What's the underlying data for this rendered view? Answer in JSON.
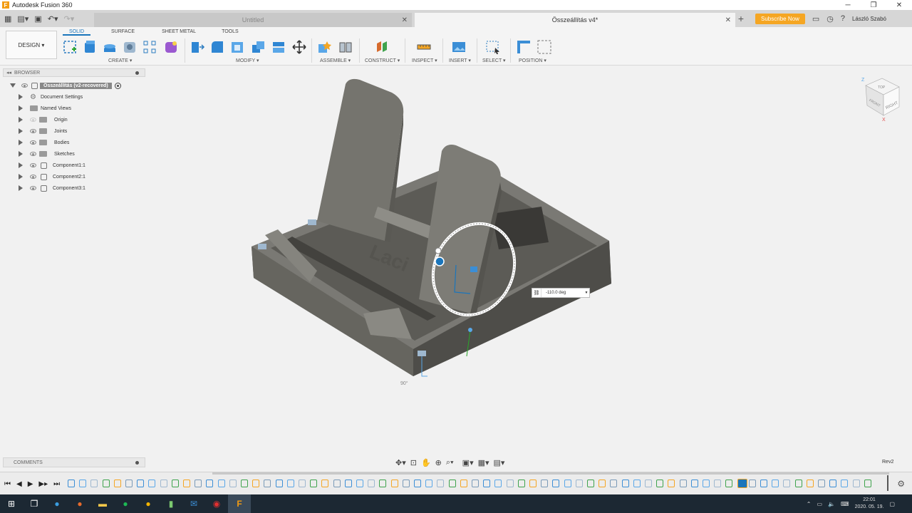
{
  "window": {
    "title": "Autodesk Fusion 360",
    "app_logo": "F"
  },
  "tabs": [
    {
      "label": "Untitled",
      "active": false
    },
    {
      "label": "Összeállítás v4*",
      "active": true
    }
  ],
  "header": {
    "subscribe_label": "Subscribe Now",
    "user_name": "László Szabó"
  },
  "ribbon": {
    "workspace_label": "DESIGN ▾",
    "workspace_tabs": [
      "SOLID",
      "SURFACE",
      "SHEET METAL",
      "TOOLS"
    ],
    "groups": [
      "CREATE ▾",
      "MODIFY ▾",
      "ASSEMBLE ▾",
      "CONSTRUCT ▾",
      "INSPECT ▾",
      "INSERT ▾",
      "SELECT ▾",
      "POSITION ▾"
    ]
  },
  "browser": {
    "title": "BROWSER",
    "root": "Összeállítás (v2-recovered)",
    "items": [
      {
        "label": "Document Settings",
        "icon": "gear-icon"
      },
      {
        "label": "Named Views",
        "icon": "folder-icon"
      },
      {
        "label": "Origin",
        "icon": "folder-icon"
      },
      {
        "label": "Joints",
        "icon": "folder-icon"
      },
      {
        "label": "Bodies",
        "icon": "folder-icon"
      },
      {
        "label": "Sketches",
        "icon": "folder-icon"
      },
      {
        "label": "Component1:1",
        "icon": "component-icon"
      },
      {
        "label": "Component2:1",
        "icon": "component-icon"
      },
      {
        "label": "Component3:1",
        "icon": "component-icon"
      }
    ]
  },
  "comments": {
    "title": "COMMENTS"
  },
  "viewport": {
    "model_text": "Laci",
    "angle_value": "-110.0 deg",
    "view_cube_face": "RIGHT",
    "view_cube_top": "TOP",
    "view_cube_front": "FRONT",
    "axis_z": "Z",
    "axis_x": "X",
    "angle_mark": "90°"
  },
  "status": {
    "revision": "Rev2"
  },
  "taskbar": {
    "time": "22:01",
    "date": "2020. 05. 19."
  },
  "colors": {
    "accent": "#1a75bb",
    "subscribe": "#f5a623",
    "model": "#6e6d68",
    "taskbar": "#1c2833"
  }
}
